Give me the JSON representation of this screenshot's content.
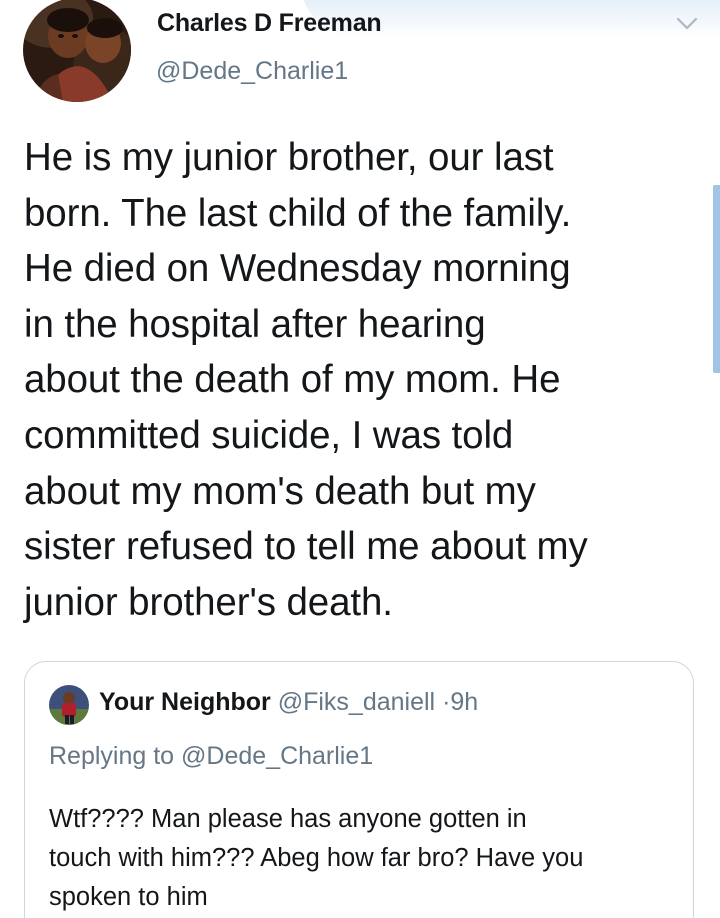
{
  "tweet": {
    "author": {
      "display_name": "Charles D Freeman",
      "handle": "@Dede_Charlie1",
      "avatar_icon": "profile-photo-children"
    },
    "more_icon": "chevron-down-icon",
    "text_lines": [
      "He is my junior brother, our last",
      "born. The last child of the family.",
      "He died on Wednesday morning",
      "in the hospital after hearing",
      "about the death of my mom. He",
      "committed suicide, I was told",
      "about my mom's death but my",
      "sister refused to tell me about my",
      "junior brother's death."
    ]
  },
  "quoted_tweet": {
    "display_name": "Your Neighbor",
    "handle": "@Fiks_daniell",
    "separator": "·",
    "time": "9h",
    "replying_to": "Replying to @Dede_Charlie1",
    "text_lines": [
      "Wtf???? Man please has anyone gotten in",
      "touch with him??? Abeg how far bro? Have you",
      "spoken to him"
    ]
  },
  "colors": {
    "text_primary": "#14171a",
    "text_secondary": "#657786",
    "card_border": "#ccd6dd",
    "scroll_accent": "#9fc4e6"
  }
}
